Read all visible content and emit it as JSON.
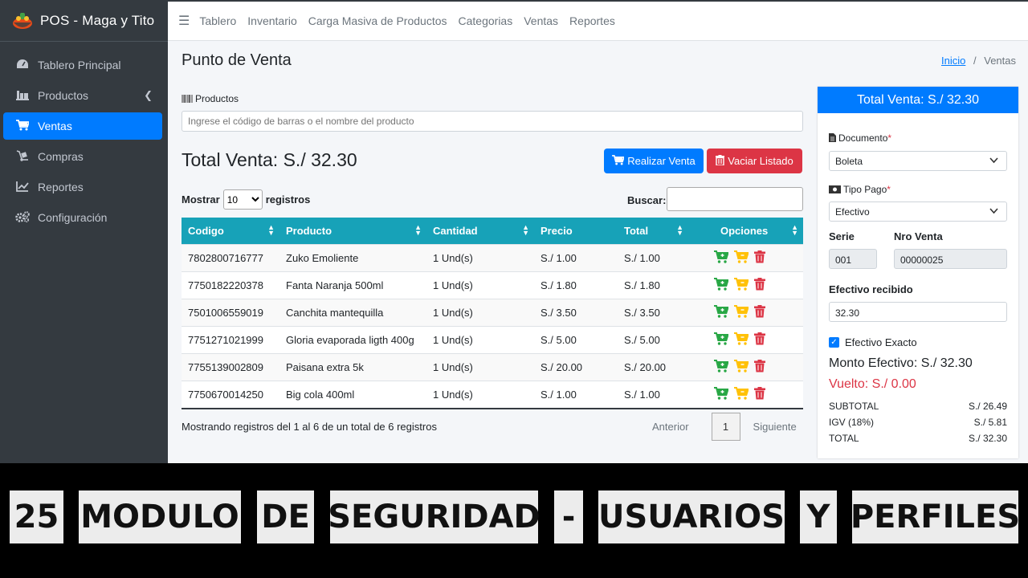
{
  "app": {
    "title": "POS - Maga y Tito"
  },
  "sidebar": {
    "items": [
      {
        "label": "Tablero Principal",
        "icon": "dashboard-icon"
      },
      {
        "label": "Productos",
        "icon": "products-icon"
      },
      {
        "label": "Ventas",
        "icon": "cart-icon",
        "active": true
      },
      {
        "label": "Compras",
        "icon": "dolly-icon"
      },
      {
        "label": "Reportes",
        "icon": "chart-icon"
      },
      {
        "label": "Configuración",
        "icon": "gears-icon"
      }
    ]
  },
  "topnav": {
    "links": [
      "Tablero",
      "Inventario",
      "Carga Masiva de Productos",
      "Categorias",
      "Ventas",
      "Reportes"
    ]
  },
  "page": {
    "title": "Punto de Venta",
    "breadcrumb": {
      "home": "Inicio",
      "separator": "/",
      "current": "Ventas"
    }
  },
  "form": {
    "products_label": "Productos",
    "products_placeholder": "Ingrese el código de barras o el nombre del producto"
  },
  "sale": {
    "total_text": "Total Venta: S./ 32.30",
    "btn_sale": "Realizar Venta",
    "btn_clear": "Vaciar Listado"
  },
  "table": {
    "show_label": "Mostrar",
    "show_value": "10",
    "records_label": "registros",
    "search_label": "Buscar:",
    "headers": [
      "Codigo",
      "Producto",
      "Cantidad",
      "Precio",
      "Total",
      "Opciones"
    ],
    "rows": [
      [
        "7802800716777",
        "Zuko Emoliente",
        "1 Und(s)",
        "S./ 1.00",
        "S./ 1.00"
      ],
      [
        "7750182220378",
        "Fanta Naranja 500ml",
        "1 Und(s)",
        "S./ 1.80",
        "S./ 1.80"
      ],
      [
        "7501006559019",
        "Canchita mantequilla",
        "1 Und(s)",
        "S./ 3.50",
        "S./ 3.50"
      ],
      [
        "7751271021999",
        "Gloria evaporada ligth 400g",
        "1 Und(s)",
        "S./ 5.00",
        "S./ 5.00"
      ],
      [
        "7755139002809",
        "Paisana extra 5k",
        "1 Und(s)",
        "S./ 20.00",
        "S./ 20.00"
      ],
      [
        "7750670014250",
        "Big cola 400ml",
        "1 Und(s)",
        "S./ 1.00",
        "S./ 1.00"
      ]
    ],
    "info": "Mostrando registros del 1 al 6 de un total de 6 registros",
    "pager": {
      "prev": "Anterior",
      "page": "1",
      "next": "Siguiente"
    }
  },
  "panel": {
    "header": "Total Venta: S./ 32.30",
    "documento_label": "Documento",
    "documento_value": "Boleta",
    "tipo_pago_label": "Tipo Pago",
    "tipo_pago_value": "Efectivo",
    "required_mark": "*",
    "serie_label": "Serie",
    "serie_value": "001",
    "nro_label": "Nro Venta",
    "nro_value": "00000025",
    "efectivo_label": "Efectivo recibido",
    "efectivo_value": "32.30",
    "exacto_label": "Efectivo Exacto",
    "monto": "Monto Efectivo: S./ 32.30",
    "vuelto": "Vuelto: S./ 0.00",
    "summary": [
      {
        "label": "SUBTOTAL",
        "value": "S./ 26.49"
      },
      {
        "label": "IGV (18%)",
        "value": "S./ 5.81"
      },
      {
        "label": "TOTAL",
        "value": "S./ 32.30"
      }
    ]
  },
  "banner": {
    "words": [
      "25",
      "MODULO",
      "DE",
      "SEGURIDAD",
      "-",
      "USUARIOS",
      "Y",
      "PERFILES"
    ]
  },
  "colors": {
    "primary": "#007bff",
    "danger": "#dc3545",
    "info": "#17a2b8",
    "success": "#28a745",
    "warning": "#ffc107",
    "sidebar": "#343a40"
  }
}
